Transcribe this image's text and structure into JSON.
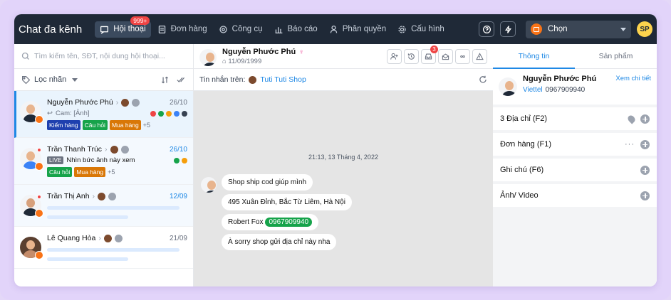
{
  "app": {
    "brand": "Chat đa kênh"
  },
  "nav": [
    {
      "label": "Hội thoại",
      "icon": "chat-icon",
      "badge": "999+",
      "active": true
    },
    {
      "label": "Đơn hàng",
      "icon": "order-icon"
    },
    {
      "label": "Công cụ",
      "icon": "tools-icon"
    },
    {
      "label": "Báo cáo",
      "icon": "chart-icon"
    },
    {
      "label": "Phân quyền",
      "icon": "user-icon"
    },
    {
      "label": "Cấu hình",
      "icon": "gear-icon"
    }
  ],
  "topbar": {
    "shop_select": "Chọn",
    "avatar": "SP"
  },
  "left": {
    "search_placeholder": "Tìm kiếm tên, SĐT, nội dung hội thoại...",
    "filter_label": "Lọc nhãn",
    "conversations": [
      {
        "name": "Nguyễn Phước Phú",
        "time": "26/10",
        "sub": "Cam: [Ảnh]",
        "tags": [
          {
            "label": "Kiểm hàng",
            "color": "#1e40af"
          },
          {
            "label": "Câu hỏi",
            "color": "#16a34a"
          },
          {
            "label": "Mua hàng",
            "color": "#d97706"
          }
        ],
        "more": "+5"
      },
      {
        "name": "Trần Thanh Trúc",
        "time": "26/10",
        "live": "LIVE",
        "sub": "Nhìn bức ảnh này xem",
        "tags": [
          {
            "label": "Câu hỏi",
            "color": "#16a34a"
          },
          {
            "label": "Mua hàng",
            "color": "#d97706"
          }
        ],
        "more": "+5"
      },
      {
        "name": "Trần Thị Anh",
        "time": "12/09"
      },
      {
        "name": "Lê Quang Hòa",
        "time": "21/09"
      }
    ]
  },
  "chat": {
    "contact_name": "Nguyễn Phước Phú",
    "birthday": "11/09/1999",
    "action_badge": "3",
    "message_on_label": "Tin nhắn trên:",
    "shop_name": "Tuti Tuti Shop",
    "timestamp": "21:13, 13 Tháng 4, 2022",
    "messages": [
      "Shop ship cod giúp mình",
      "495 Xuân Đỉnh, Bắc Từ Liêm, Hà Nội",
      "Robert Fox",
      "À sorry shop gửi địa chỉ này nha"
    ],
    "phone_chip": "0967909940"
  },
  "right": {
    "tabs": [
      "Thông tin",
      "Sản phẩm"
    ],
    "customer_name": "Nguyễn Phước Phú",
    "carrier": "Viettel",
    "phone": "0967909940",
    "detail_link": "Xem chi tiết",
    "sections": [
      "3 Địa chỉ (F2)",
      "Đơn hàng (F1)",
      "Ghi chú (F6)",
      "Ảnh/ Video"
    ]
  }
}
